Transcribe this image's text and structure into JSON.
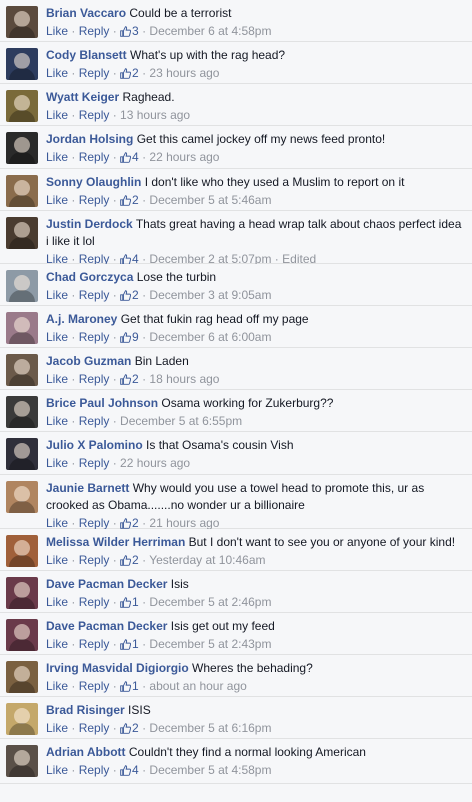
{
  "comments": [
    {
      "author": "Brian Vaccaro",
      "text": "Could be a terrorist",
      "like": "Like",
      "reply": "Reply",
      "likes": "3",
      "time": "December 6 at 4:58pm",
      "edited": "",
      "avatar": "#5b4a3d"
    },
    {
      "author": "Cody Blansett",
      "text": "What's up with the rag head?",
      "like": "Like",
      "reply": "Reply",
      "likes": "2",
      "time": "23 hours ago",
      "edited": "",
      "avatar": "#2d3c5e"
    },
    {
      "author": "Wyatt Keiger",
      "text": "Raghead.",
      "like": "Like",
      "reply": "Reply",
      "likes": "",
      "time": "13 hours ago",
      "edited": "",
      "avatar": "#7a6a3a"
    },
    {
      "author": "Jordan Holsing",
      "text": "Get this camel jockey off my news feed pronto!",
      "like": "Like",
      "reply": "Reply",
      "likes": "4",
      "time": "22 hours ago",
      "edited": "",
      "avatar": "#2a2a2a"
    },
    {
      "author": "Sonny Olaughlin",
      "text": "I don't like who they used a Muslim to report on it",
      "like": "Like",
      "reply": "Reply",
      "likes": "2",
      "time": "December 5 at 5:46am",
      "edited": "",
      "avatar": "#8a6c4c"
    },
    {
      "author": "Justin Derdock",
      "text": "Thats great having a head wrap talk about chaos perfect idea i like it lol",
      "like": "Like",
      "reply": "Reply",
      "likes": "4",
      "time": "December 2 at 5:07pm",
      "edited": "Edited",
      "avatar": "#4a3c30"
    },
    {
      "author": "Chad Gorczyca",
      "text": "Lose the turbin",
      "like": "Like",
      "reply": "Reply",
      "likes": "2",
      "time": "December 3 at 9:05am",
      "edited": "",
      "avatar": "#8d9aa6"
    },
    {
      "author": "A.j. Maroney",
      "text": "Get that fukin rag head off my page",
      "like": "Like",
      "reply": "Reply",
      "likes": "9",
      "time": "December 6 at 6:00am",
      "edited": "",
      "avatar": "#9a7a8a"
    },
    {
      "author": "Jacob Guzman",
      "text": "Bin Laden",
      "like": "Like",
      "reply": "Reply",
      "likes": "2",
      "time": "18 hours ago",
      "edited": "",
      "avatar": "#6b5a4a"
    },
    {
      "author": "Brice Paul Johnson",
      "text": "Osama working for Zukerburg??",
      "like": "Like",
      "reply": "Reply",
      "likes": "",
      "time": "December 5 at 6:55pm",
      "edited": "",
      "avatar": "#3a3a3a"
    },
    {
      "author": "Julio X Palomino",
      "text": "Is that Osama's cousin Vish",
      "like": "Like",
      "reply": "Reply",
      "likes": "",
      "time": "22 hours ago",
      "edited": "",
      "avatar": "#2f2f3a"
    },
    {
      "author": "Jaunie Barnett",
      "text": "Why would you use a towel head to promote this, ur as crooked as Obama.......no wonder ur a billionaire",
      "like": "Like",
      "reply": "Reply",
      "likes": "2",
      "time": "21 hours ago",
      "edited": "",
      "avatar": "#b08560"
    },
    {
      "author": "Melissa Wilder Herriman",
      "text": "But I don't want to see you or anyone of your kind!",
      "like": "Like",
      "reply": "Reply",
      "likes": "2",
      "time": "Yesterday at 10:46am",
      "edited": "",
      "avatar": "#a0603a"
    },
    {
      "author": "Dave Pacman Decker",
      "text": "Isis",
      "like": "Like",
      "reply": "Reply",
      "likes": "1",
      "time": "December 5 at 2:46pm",
      "edited": "",
      "avatar": "#6a3a4a"
    },
    {
      "author": "Dave Pacman Decker",
      "text": "Isis get out my feed",
      "like": "Like",
      "reply": "Reply",
      "likes": "1",
      "time": "December 5 at 2:43pm",
      "edited": "",
      "avatar": "#6a3a4a"
    },
    {
      "author": "Irving Masvidal Digiorgio",
      "text": "Wheres the behading?",
      "like": "Like",
      "reply": "Reply",
      "likes": "1",
      "time": "about an hour ago",
      "edited": "",
      "avatar": "#7a6040"
    },
    {
      "author": "Brad Risinger",
      "text": "ISIS",
      "like": "Like",
      "reply": "Reply",
      "likes": "2",
      "time": "December 5 at 6:16pm",
      "edited": "",
      "avatar": "#c4a86a"
    },
    {
      "author": "Adrian Abbott",
      "text": "Couldn't they find a normal looking American",
      "like": "Like",
      "reply": "Reply",
      "likes": "4",
      "time": "December 5 at 4:58pm",
      "edited": "",
      "avatar": "#5a5048"
    }
  ]
}
